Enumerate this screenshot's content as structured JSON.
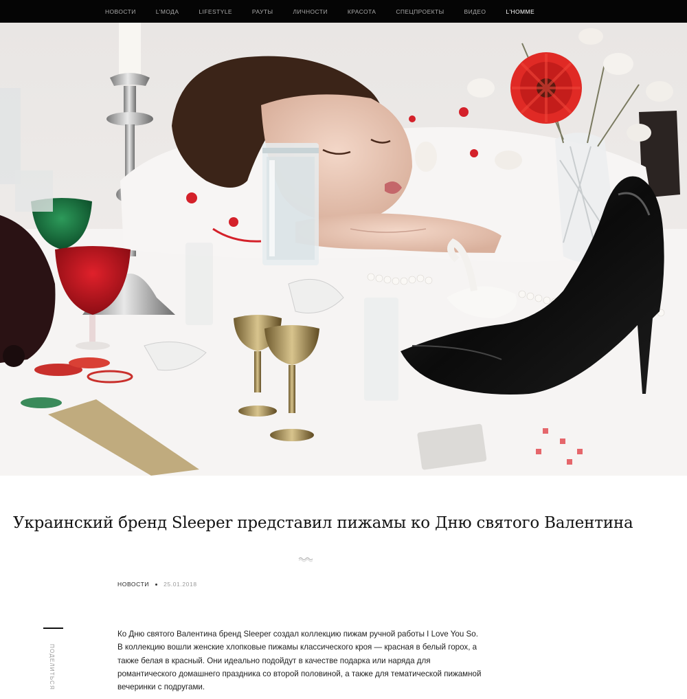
{
  "nav": {
    "items": [
      {
        "label": "НОВОСТИ",
        "active": false
      },
      {
        "label": "L'МОДА",
        "active": false
      },
      {
        "label": "LIFESTYLE",
        "active": false
      },
      {
        "label": "РАУТЫ",
        "active": false
      },
      {
        "label": "ЛИЧНОСТИ",
        "active": false
      },
      {
        "label": "КРАСОТА",
        "active": false
      },
      {
        "label": "СПЕЦПРОЕКТЫ",
        "active": false
      },
      {
        "label": "ВИДЕО",
        "active": false
      },
      {
        "label": "L'HOMME",
        "active": true
      }
    ]
  },
  "article": {
    "title": "Украинский бренд Sleeper представил пижамы ко Дню святого Валентина",
    "category": "НОВОСТИ",
    "date": "25.01.2018",
    "share_label": "ПОДЕЛИТЬСЯ",
    "body": "Ко Дню святого Валентина бренд Sleeper создал коллекцию пижам ручной работы I Love You So. В коллекцию вошли женские хлопковые пижамы классического кроя — красная в белый горох, а также белая в красный. Они идеально подойдут в качестве подарка или наряда для романтического домашнего праздника со второй половиной, а также для тематической пижамной вечеринки с подругами."
  },
  "colors": {
    "nav_bg": "#050505",
    "nav_text": "#a9a9a9",
    "nav_active": "#ffffff",
    "accent_red": "#d4212a"
  }
}
